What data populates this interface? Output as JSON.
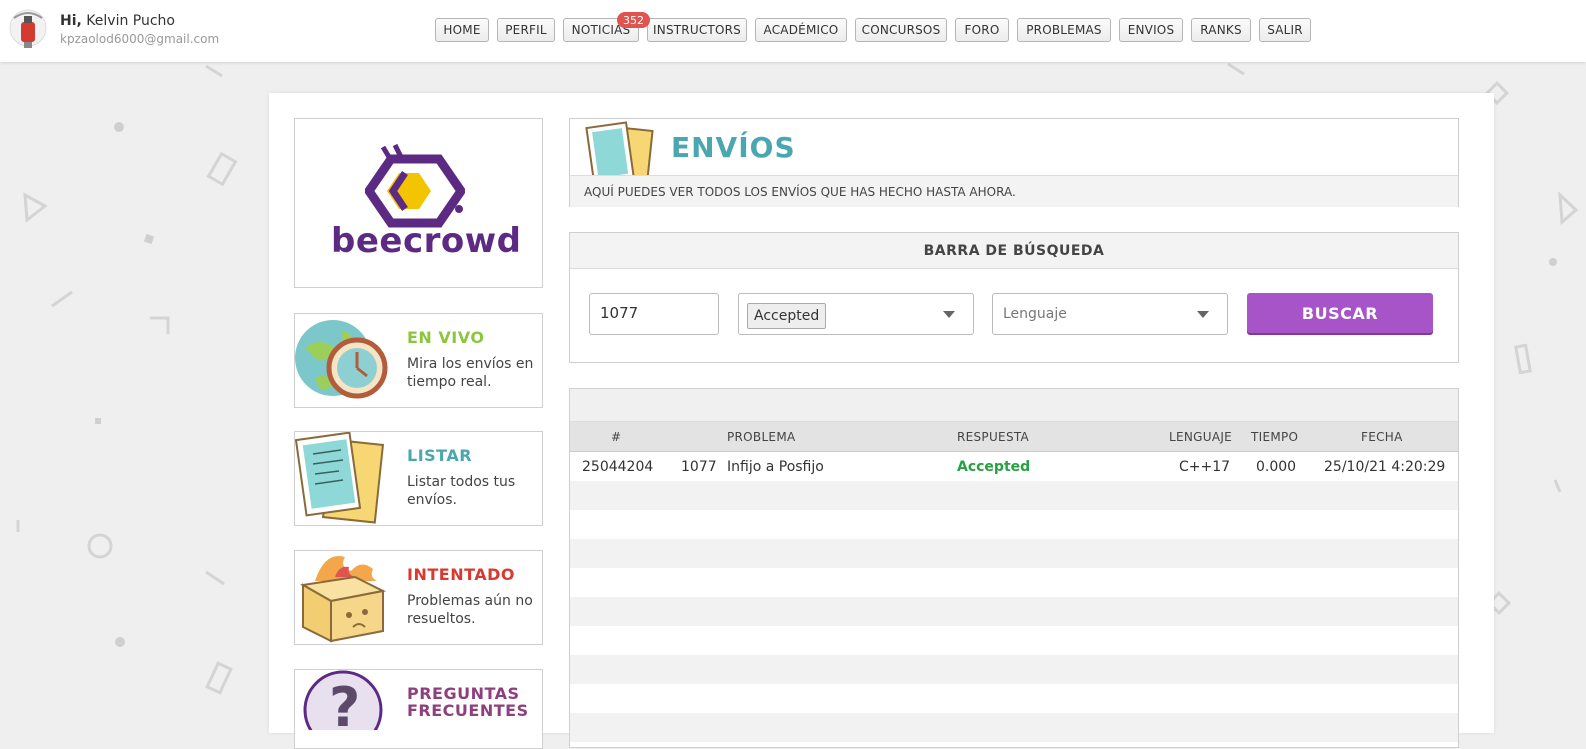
{
  "user": {
    "hi": "Hi,",
    "name": "Kelvin Pucho",
    "email": "kpzaolod6000@gmail.com"
  },
  "nav": {
    "items": [
      "HOME",
      "PERFIL",
      "NOTICIAS",
      "INSTRUCTORS",
      "ACADÉMICO",
      "CONCURSOS",
      "FORO",
      "PROBLEMAS",
      "ENVIOS",
      "RANKS",
      "SALIR"
    ],
    "news_badge": "352"
  },
  "logo": {
    "text": "beecrowd",
    "color": "#5d2a83",
    "accent": "#f3c400"
  },
  "sidebar": {
    "items": [
      {
        "title": "EN VIVO",
        "desc": "Mira los envíos en tiempo real.",
        "color": "#8cc63e",
        "icon": "globe-clock-icon"
      },
      {
        "title": "LISTAR",
        "desc": "Listar todos tus envíos.",
        "color": "#4aa7b0",
        "icon": "papers-icon"
      },
      {
        "title": "INTENTADO",
        "desc": "Problemas aún no resueltos.",
        "color": "#d9392e",
        "icon": "burning-box-icon"
      },
      {
        "title": "PREGUNTAS FRECUENTES",
        "desc": "",
        "color": "#8e3f7e",
        "icon": "question-icon"
      }
    ]
  },
  "header": {
    "title": "ENVÍOS",
    "subtitle": "AQUÍ PUEDES VER TODOS LOS ENVÍOS QUE HAS HECHO HASTA AHORA."
  },
  "search": {
    "title": "BARRA DE BÚSQUEDA",
    "problem_value": "1077",
    "answer_selected": "Accepted",
    "language_placeholder": "Lenguaje",
    "button": "BUSCAR"
  },
  "table": {
    "headers": [
      "#",
      "PROBLEMA",
      "RESPUESTA",
      "LENGUAJE",
      "TIEMPO",
      "FECHA"
    ],
    "rows": [
      {
        "id": "25044204",
        "problem_id": "1077",
        "problem": "Infijo a Posfijo",
        "answer": "Accepted",
        "language": "C++17",
        "time": "0.000",
        "date": "25/10/21 4:20:29"
      }
    ]
  },
  "colors": {
    "accent_purple": "#a654c8",
    "accepted_green": "#27a143",
    "teal": "#4aa7b0"
  }
}
